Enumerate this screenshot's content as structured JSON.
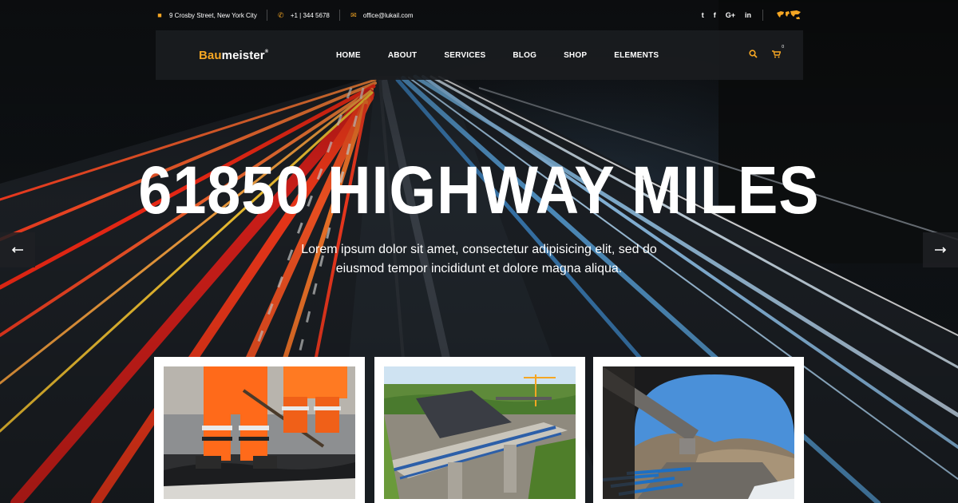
{
  "topbar": {
    "address": "9 Crosby Street, New York City",
    "phone": "+1 | 344 5678",
    "email": "office@lukail.com",
    "social": [
      {
        "name": "twitter",
        "glyph": "t"
      },
      {
        "name": "facebook",
        "glyph": "f"
      },
      {
        "name": "google-plus",
        "glyph": "G+"
      },
      {
        "name": "linkedin",
        "glyph": "in"
      }
    ]
  },
  "brand": {
    "accent_part": "Bau",
    "rest": "meister",
    "mark": "®",
    "accent_color": "#f5a623"
  },
  "nav": {
    "items": [
      "HOME",
      "ABOUT",
      "SERVICES",
      "BLOG",
      "SHOP",
      "ELEMENTS"
    ],
    "cart_count": "0"
  },
  "hero": {
    "headline": "61850 HIGHWAY MILES",
    "subtitle": "Lorem ipsum dolor sit amet, consectetur adipisicing elit, sed do eiusmod tempor incididunt et dolore magna aliqua."
  },
  "icons": {
    "prev": "arrow-left-icon",
    "next": "arrow-right-icon",
    "search": "search-icon",
    "cart": "cart-icon"
  },
  "cards": [
    {
      "subject": "road workers in orange hi-vis laying asphalt"
    },
    {
      "subject": "highway overpass bridge construction site"
    },
    {
      "subject": "tunnel exit with pipes and mountain view"
    }
  ]
}
